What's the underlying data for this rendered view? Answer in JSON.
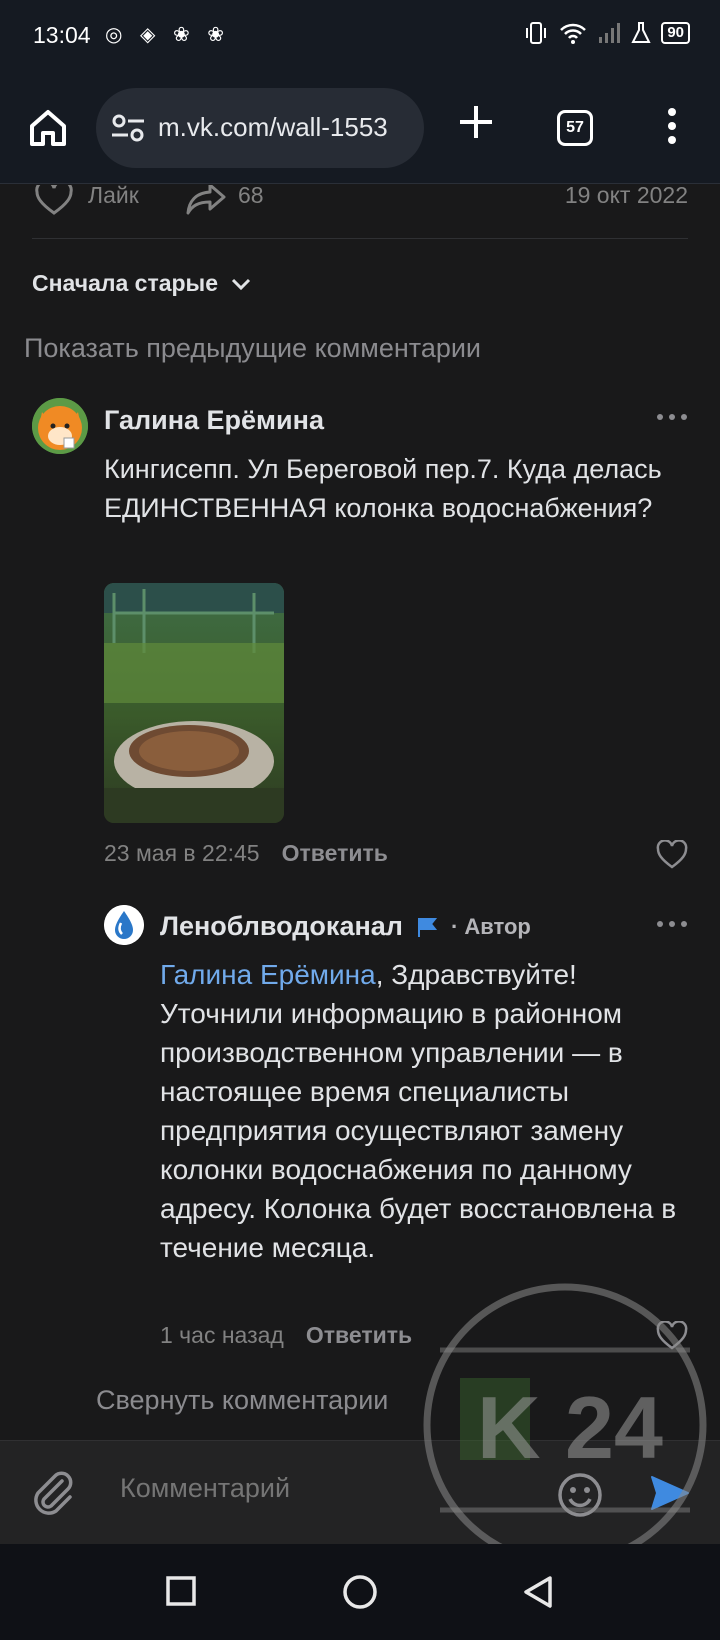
{
  "status_bar": {
    "time": "13:04",
    "notification_icons": "◎ ◈ ❀ ❀",
    "battery": "90"
  },
  "browser": {
    "url": "m.vk.com/wall-1553",
    "tab_count": "57"
  },
  "post": {
    "like_label": "Лайк",
    "share_count": "68",
    "date": "19 окт 2022"
  },
  "comments_header": {
    "sort_label": "Сначала старые",
    "show_previous": "Показать предыдущие комментарии"
  },
  "comment": {
    "author": "Галина Ерёмина",
    "text": "Кингисепп. Ул Береговой пер.7. Куда делась ЕДИНСТВЕННАЯ колонка водоснабжения?",
    "date": "23 мая в 22:45",
    "reply_label": "Ответить"
  },
  "reply": {
    "author": "Леноблводоканал",
    "author_tag": "· Автор",
    "mention": "Галина Ерёмина",
    "text": ", Здравствуйте! Уточнили информацию в районном производственном управлении — в настоящее время специалисты предприятия осуществляют замену колонки водоснабжения по данному адресу. Колонка будет восстановлена в течение месяца.",
    "date": "1 час назад",
    "reply_label": "Ответить"
  },
  "collapse_label": "Свернуть комментарии",
  "composer": {
    "placeholder": "Комментарий"
  },
  "watermark": {
    "text": "K 24"
  },
  "colors": {
    "background": "#19191a",
    "link": "#71aaeb",
    "secondary_text": "#828282",
    "send": "#3f8ae0"
  }
}
